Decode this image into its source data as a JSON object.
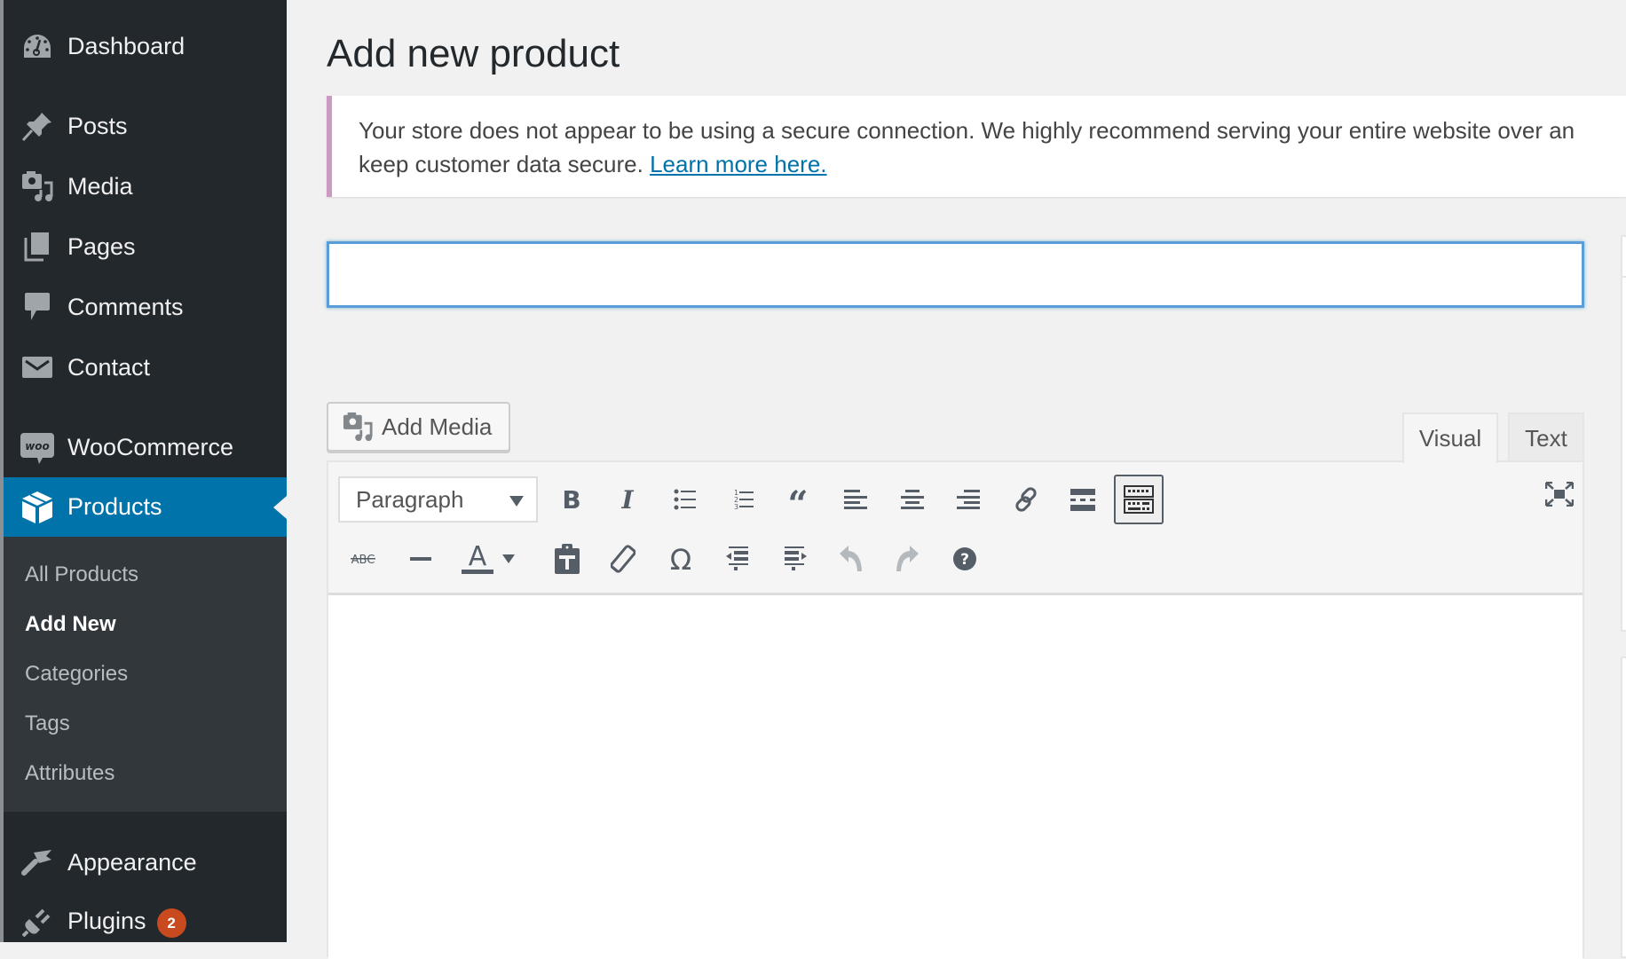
{
  "sidebar": {
    "items": [
      {
        "label": "Dashboard",
        "icon": "dashboard-icon"
      },
      {
        "label": "Posts",
        "icon": "pin-icon"
      },
      {
        "label": "Media",
        "icon": "media-icon"
      },
      {
        "label": "Pages",
        "icon": "pages-icon"
      },
      {
        "label": "Comments",
        "icon": "comment-icon"
      },
      {
        "label": "Contact",
        "icon": "envelope-icon"
      },
      {
        "label": "WooCommerce",
        "icon": "woo-icon"
      },
      {
        "label": "Products",
        "icon": "box-icon",
        "current": true
      },
      {
        "label": "Appearance",
        "icon": "paintbrush-icon"
      },
      {
        "label": "Plugins",
        "icon": "plug-icon",
        "badge": "2"
      }
    ],
    "submenu": [
      {
        "label": "All Products"
      },
      {
        "label": "Add New",
        "current": true
      },
      {
        "label": "Categories"
      },
      {
        "label": "Tags"
      },
      {
        "label": "Attributes"
      }
    ]
  },
  "page": {
    "title": "Add new product",
    "notice": {
      "text_line1": "Your store does not appear to be using a secure connection. We highly recommend serving your entire website over an",
      "text_line2": "keep customer data secure. ",
      "link_label": "Learn more here.",
      "border_color": "#cc99c2"
    },
    "title_input": {
      "value": "",
      "placeholder": ""
    },
    "add_media_label": "Add Media",
    "tabs": {
      "visual": "Visual",
      "text": "Text",
      "active": "visual"
    },
    "toolbar": {
      "format_select": "Paragraph",
      "row1": [
        "bold",
        "italic",
        "bulleted-list",
        "numbered-list",
        "blockquote",
        "align-left",
        "align-center",
        "align-right",
        "insert-link",
        "read-more",
        "toolbar-toggle"
      ],
      "row2": [
        "strikethrough",
        "horizontal-line",
        "text-color",
        "text-color-dropdown",
        "paste-as-text",
        "clear-formatting",
        "special-character",
        "decrease-indent",
        "increase-indent",
        "undo",
        "redo",
        "keyboard-shortcuts"
      ],
      "fullscreen": "distraction-free-mode"
    },
    "editor_content": ""
  },
  "colors": {
    "sidebar_bg": "#23282d",
    "submenu_bg": "#32373c",
    "accent": "#0073aa",
    "badge": "#ca4a1f",
    "focus_border": "#5b9dd9"
  }
}
